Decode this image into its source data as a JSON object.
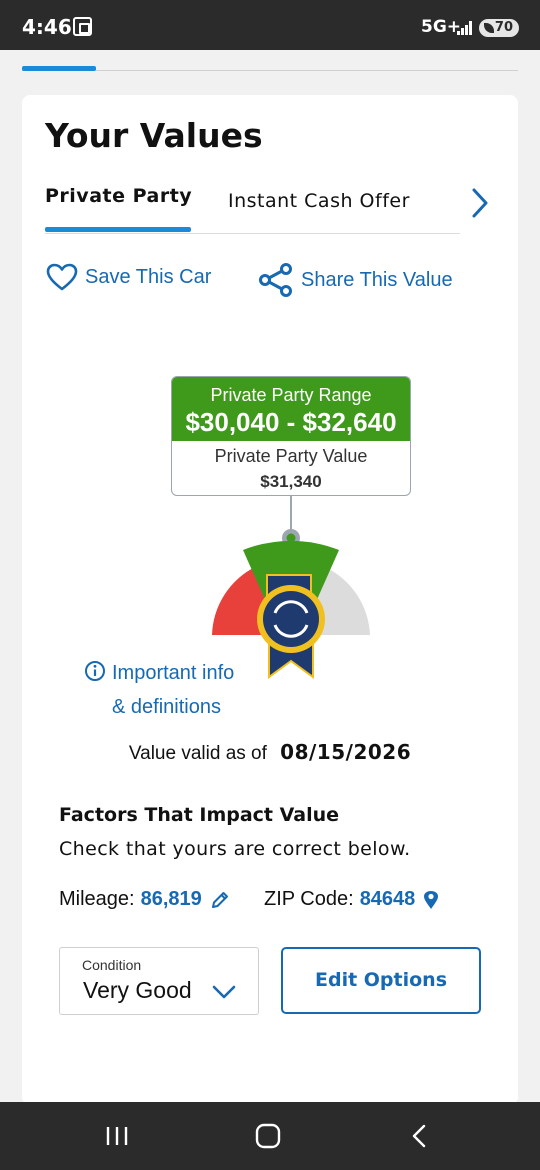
{
  "status_bar": {
    "time": "4:46",
    "network": "5G+",
    "battery": "70",
    "icons": [
      "screen-record-icon",
      "signal-icon",
      "battery-icon"
    ]
  },
  "progress": {
    "fraction": 0.15,
    "color": "#1a8bd8"
  },
  "page": {
    "title": "Your Values",
    "tabs": [
      {
        "label": "Private Party",
        "active": true
      },
      {
        "label": "Instant Cash Offer",
        "active": false
      }
    ],
    "next_tab_icon": "chevron-right-icon"
  },
  "actions": {
    "save_label": "Save This Car",
    "save_icon": "heart-icon",
    "share_label": "Share This Value",
    "share_icon": "share-icon"
  },
  "valuation": {
    "range_label": "Private Party Range",
    "range_value": "$30,040 - $32,640",
    "value_label": "Private Party Value",
    "value_amount": "$31,340",
    "range_color": "#3f9a1c",
    "gauge_icon": "kbb-ribbon-icon"
  },
  "info": {
    "line1": "Important info",
    "line2": "& definitions",
    "icon": "info-icon"
  },
  "validity": {
    "label": "Value valid as of",
    "date": "08/15/2026"
  },
  "factors": {
    "title": "Factors That Impact Value",
    "subtitle": "Check that yours are correct below.",
    "mileage_label": "Mileage:",
    "mileage_value": "86,819",
    "zip_label": "ZIP Code:",
    "zip_value": "84648"
  },
  "condition": {
    "label": "Condition",
    "selected": "Very Good"
  },
  "edit_options_label": "Edit Options",
  "nav_bar": {
    "icons": [
      "recent-apps-icon",
      "home-icon",
      "back-icon"
    ]
  },
  "colors": {
    "accent": "#1769b3",
    "tab_underline": "#1a8bd8",
    "gauge_red": "#e8403a",
    "gauge_green": "#3f9a1c",
    "gauge_gray": "#dcdcdc",
    "ribbon_navy": "#1f3a6e",
    "ribbon_gold": "#f0c020"
  }
}
